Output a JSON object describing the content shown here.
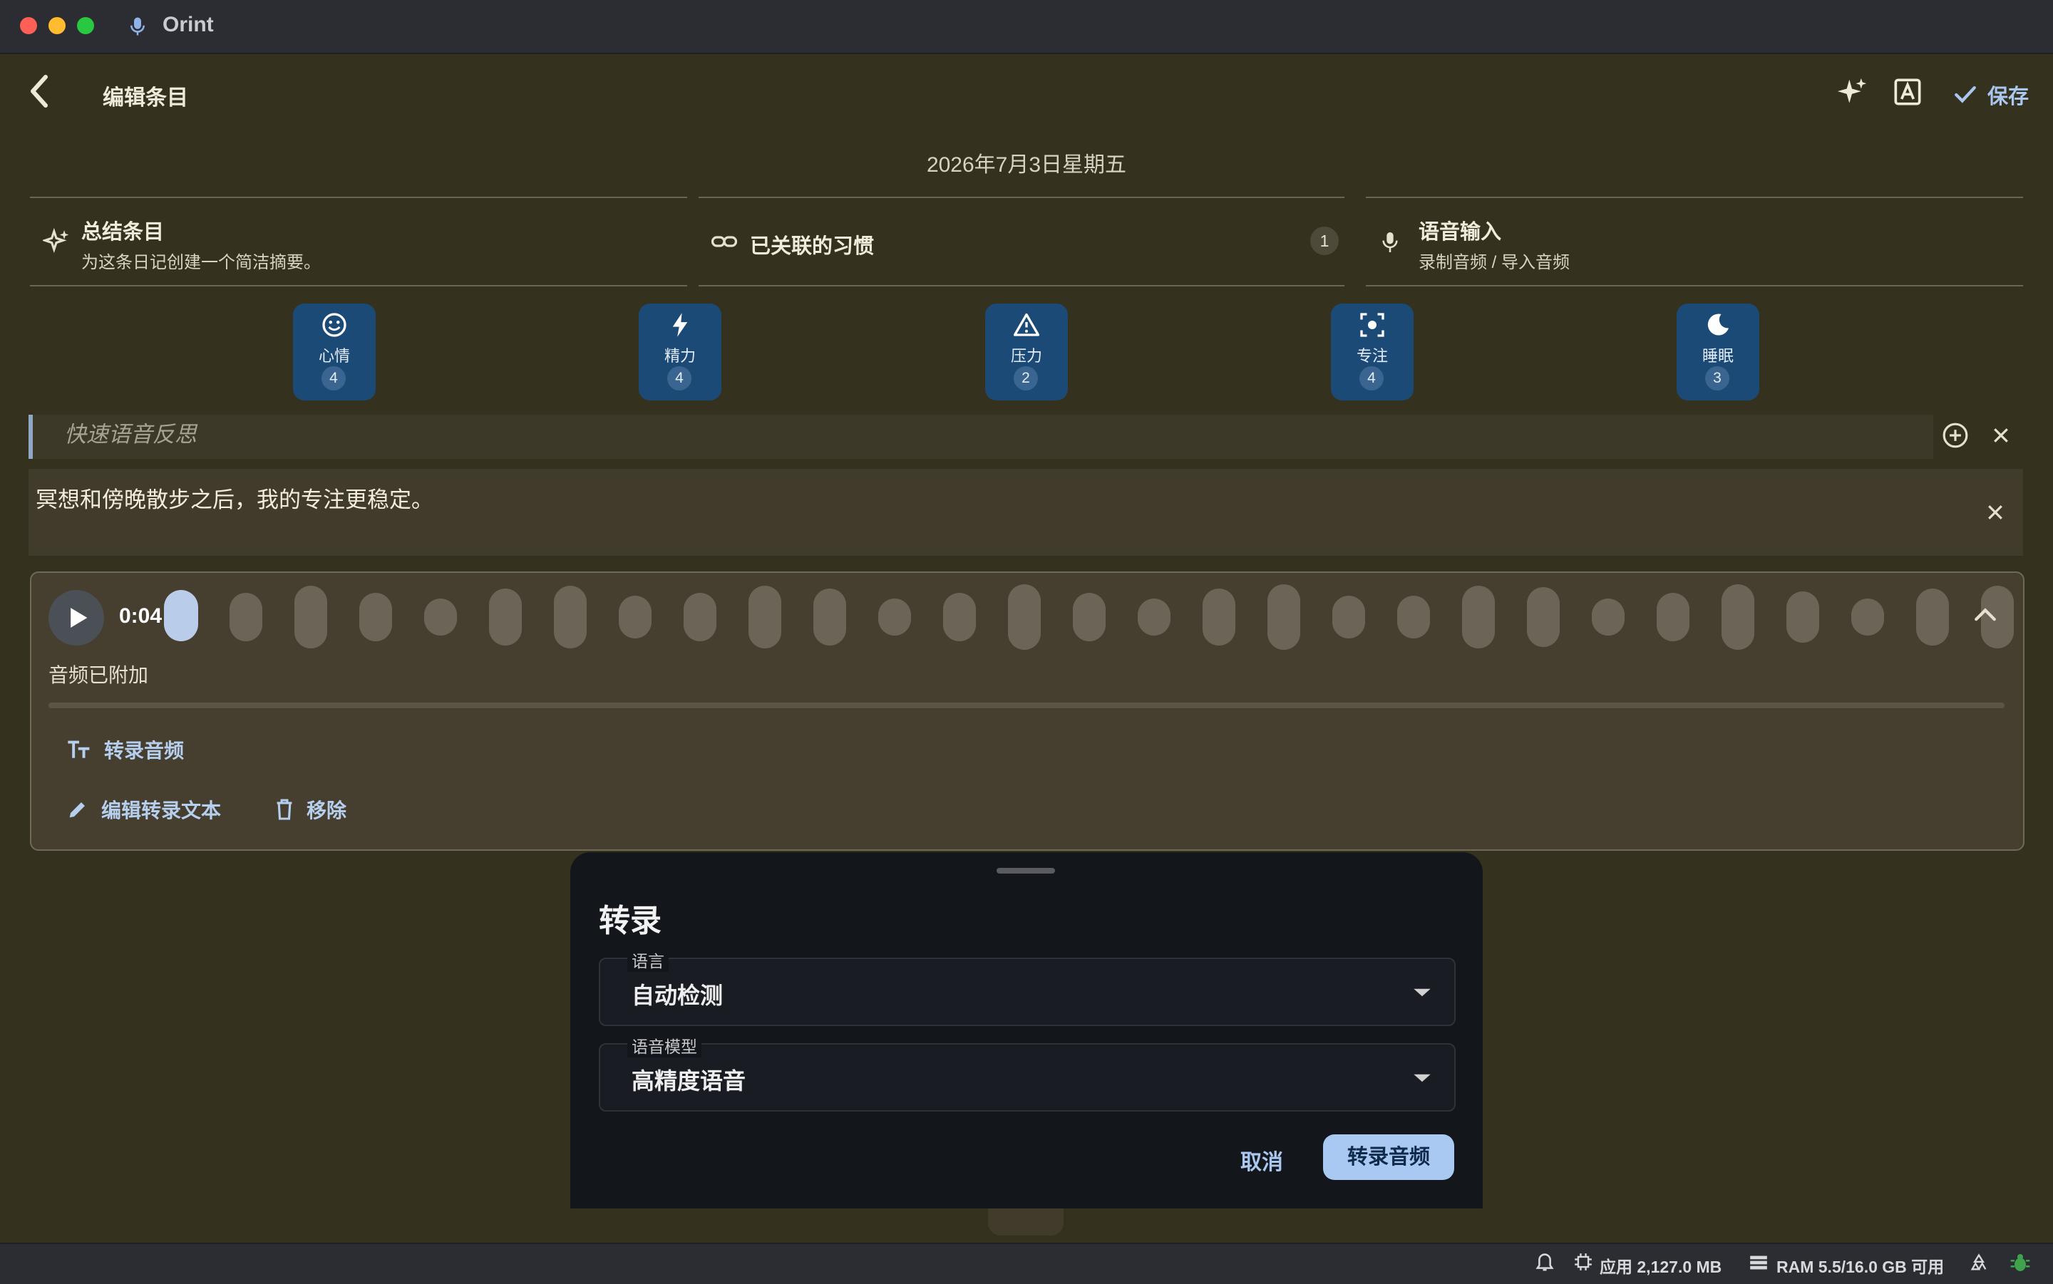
{
  "window": {
    "app_title": "Orint"
  },
  "header": {
    "title": "编辑条目",
    "save_label": "保存"
  },
  "date": "2026年7月3日星期五",
  "cards": {
    "summary": {
      "title": "总结条目",
      "subtitle": "为这条日记创建一个简洁摘要。"
    },
    "habits": {
      "title": "已关联的习惯",
      "count": "1"
    },
    "voice": {
      "title": "语音输入",
      "subtitle": "录制音频 / 导入音频"
    }
  },
  "metrics": [
    {
      "label": "心情",
      "value": "4",
      "icon": "smile-icon"
    },
    {
      "label": "精力",
      "value": "4",
      "icon": "bolt-icon"
    },
    {
      "label": "压力",
      "value": "2",
      "icon": "warning-icon"
    },
    {
      "label": "专注",
      "value": "4",
      "icon": "focus-icon"
    },
    {
      "label": "睡眠",
      "value": "3",
      "icon": "moon-icon"
    }
  ],
  "reflection": {
    "placeholder": "快速语音反思"
  },
  "note": {
    "text": "冥想和傍晚散步之后，我的专注更稳定。"
  },
  "audio": {
    "time": "0:04",
    "status": "音频已附加",
    "transcribe_label": "转录音频",
    "edit_label": "编辑转录文本",
    "remove_label": "移除"
  },
  "dialog": {
    "title": "转录",
    "language_label": "语言",
    "language_value": "自动检测",
    "model_label": "语音模型",
    "model_value": "高精度语音",
    "cancel_label": "取消",
    "confirm_label": "转录音频"
  },
  "statusbar": {
    "app_mem": "应用 2,127.0 MB",
    "ram": "RAM 5.5/16.0 GB 可用"
  },
  "colors": {
    "background": "#35311f",
    "accent": "#a9c7ef",
    "metric_tile": "#1c4a76",
    "dialog": "#13161b"
  }
}
